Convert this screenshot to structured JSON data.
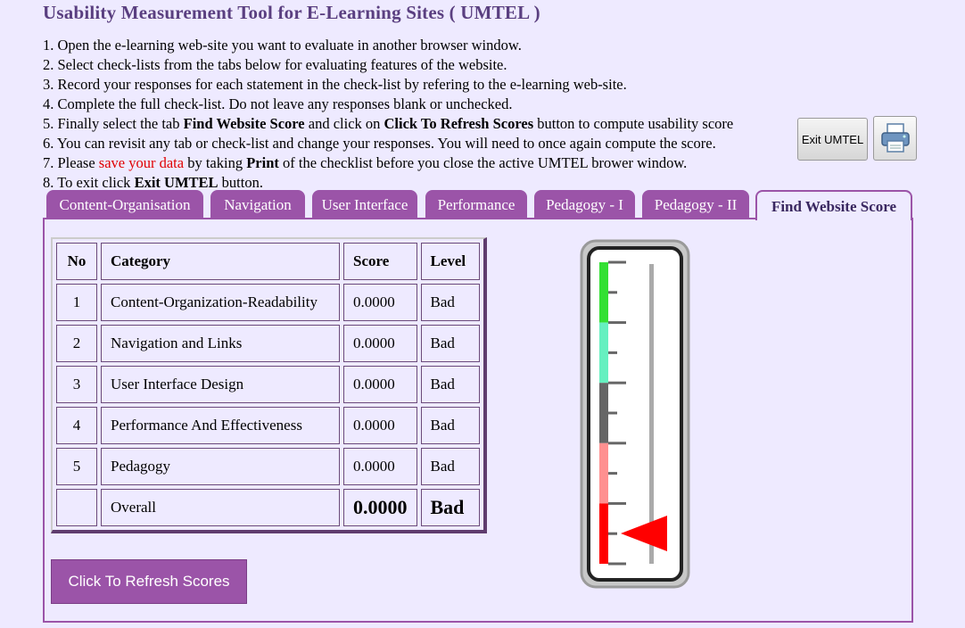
{
  "page": {
    "title": "Usability Measurement Tool for E-Learning Sites ( UMTEL )"
  },
  "instructions": {
    "i1": "1. Open the e-learning web-site you want to evaluate in another browser window.",
    "i2": "2. Select check-lists from the tabs below for evaluating features of the website.",
    "i3": "3. Record your responses for each statement in the check-list by refering to the e-learning web-site.",
    "i4": "4. Complete the full check-list. Do not leave any responses blank or unchecked.",
    "i5_a": "5. Finally select the tab ",
    "i5_b": "Find Website Score",
    "i5_c": " and click on ",
    "i5_d": "Click To Refresh Scores",
    "i5_e": " button to compute usability score",
    "i6": "6. You can revisit any tab or check-list and change your responses. You will need to once again compute the score.",
    "i7_a": "7. Please ",
    "i7_b": "save your data",
    "i7_c": " by taking ",
    "i7_d": "Print",
    "i7_e": " of the checklist before you close the active UMTEL brower window.",
    "i8_a": "8. To exit click ",
    "i8_b": "Exit UMTEL",
    "i8_c": " button."
  },
  "toolbar": {
    "exit_label": "Exit UMTEL",
    "print_icon": "printer-icon"
  },
  "tabs": [
    {
      "label": "Content-Organisation"
    },
    {
      "label": "Navigation"
    },
    {
      "label": "User Interface"
    },
    {
      "label": "Performance"
    },
    {
      "label": "Pedagogy - I"
    },
    {
      "label": "Pedagogy - II"
    },
    {
      "label": "Find Website Score",
      "active": true
    }
  ],
  "table": {
    "headers": {
      "no": "No",
      "category": "Category",
      "score": "Score",
      "level": "Level"
    },
    "rows": [
      {
        "no": "1",
        "category": "Content-Organization-Readability",
        "score": "0.0000",
        "level": "Bad"
      },
      {
        "no": "2",
        "category": "Navigation and Links",
        "score": "0.0000",
        "level": "Bad"
      },
      {
        "no": "3",
        "category": "User Interface Design",
        "score": "0.0000",
        "level": "Bad"
      },
      {
        "no": "4",
        "category": "Performance And Effectiveness",
        "score": "0.0000",
        "level": "Bad"
      },
      {
        "no": "5",
        "category": "Pedagogy",
        "score": "0.0000",
        "level": "Bad"
      }
    ],
    "overall": {
      "no": "",
      "category": "Overall",
      "score": "0.0000",
      "level": "Bad"
    }
  },
  "refresh_button": {
    "label": "Click To Refresh Scores"
  },
  "gauge": {
    "colors": [
      "#33e033",
      "#66f0c0",
      "#666666",
      "#ff9090",
      "#ff0000"
    ],
    "pointer_color": "#ff0000",
    "level_fraction": 0.0
  }
}
